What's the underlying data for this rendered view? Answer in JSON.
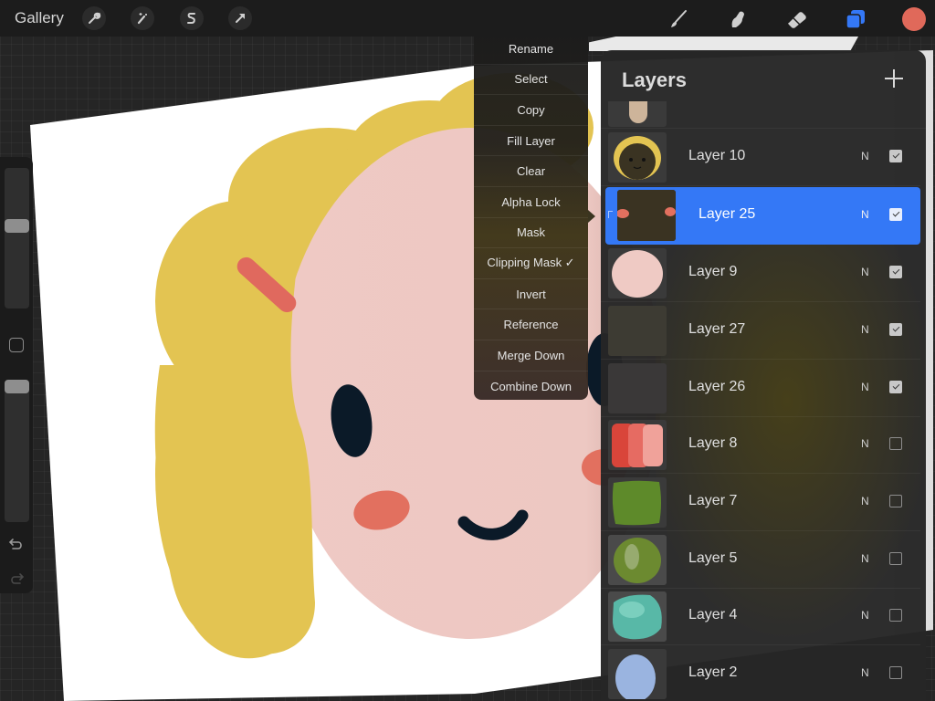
{
  "toolbar": {
    "gallery_label": "Gallery",
    "left_tools": [
      {
        "name": "actions",
        "icon": "wrench-icon"
      },
      {
        "name": "adjustments",
        "icon": "magic-wand-icon"
      },
      {
        "name": "selection",
        "icon": "selection-s-icon"
      },
      {
        "name": "transform",
        "icon": "arrow-cursor-icon"
      }
    ],
    "right_tools": [
      {
        "name": "brush",
        "icon": "brush-icon"
      },
      {
        "name": "smudge",
        "icon": "smudge-finger-icon"
      },
      {
        "name": "eraser",
        "icon": "eraser-icon"
      },
      {
        "name": "layers",
        "icon": "layers-icon",
        "active": true
      }
    ],
    "active_color": "#e0695a",
    "accent_color": "#3478f6"
  },
  "sidebar": {
    "brush_size_level": 0.6,
    "opacity_level": 1.0,
    "modify_button": "modify-square-icon",
    "undo_icon": "undo-icon",
    "redo_icon": "redo-icon"
  },
  "context_menu": {
    "items": [
      {
        "label": "Rename"
      },
      {
        "label": "Select"
      },
      {
        "label": "Copy"
      },
      {
        "label": "Fill Layer"
      },
      {
        "label": "Clear"
      },
      {
        "label": "Alpha Lock"
      },
      {
        "label": "Mask"
      },
      {
        "label": "Clipping Mask ✓"
      },
      {
        "label": "Invert"
      },
      {
        "label": "Reference"
      },
      {
        "label": "Merge Down"
      },
      {
        "label": "Combine Down"
      }
    ]
  },
  "layers_panel": {
    "title": "Layers",
    "add_icon": "plus-icon",
    "layers": [
      {
        "name": "Layer 10",
        "blend": "N",
        "visible": true,
        "selected": false,
        "thumb": "hair"
      },
      {
        "name": "Layer 25",
        "blend": "N",
        "visible": true,
        "selected": true,
        "clipped": true,
        "thumb": "cheeks"
      },
      {
        "name": "Layer 9",
        "blend": "N",
        "visible": true,
        "selected": false,
        "thumb": "face"
      },
      {
        "name": "Layer 27",
        "blend": "N",
        "visible": true,
        "selected": false,
        "thumb": "empty"
      },
      {
        "name": "Layer 26",
        "blend": "N",
        "visible": true,
        "selected": false,
        "thumb": "empty"
      },
      {
        "name": "Layer 8",
        "blend": "N",
        "visible": false,
        "selected": false,
        "thumb": "red-swatches"
      },
      {
        "name": "Layer 7",
        "blend": "N",
        "visible": false,
        "selected": false,
        "thumb": "green-square"
      },
      {
        "name": "Layer 5",
        "blend": "N",
        "visible": false,
        "selected": false,
        "thumb": "green-ball"
      },
      {
        "name": "Layer 4",
        "blend": "N",
        "visible": false,
        "selected": false,
        "thumb": "teal-blob"
      },
      {
        "name": "Layer 2",
        "blend": "N",
        "visible": false,
        "selected": false,
        "thumb": "blue-circle"
      }
    ]
  }
}
